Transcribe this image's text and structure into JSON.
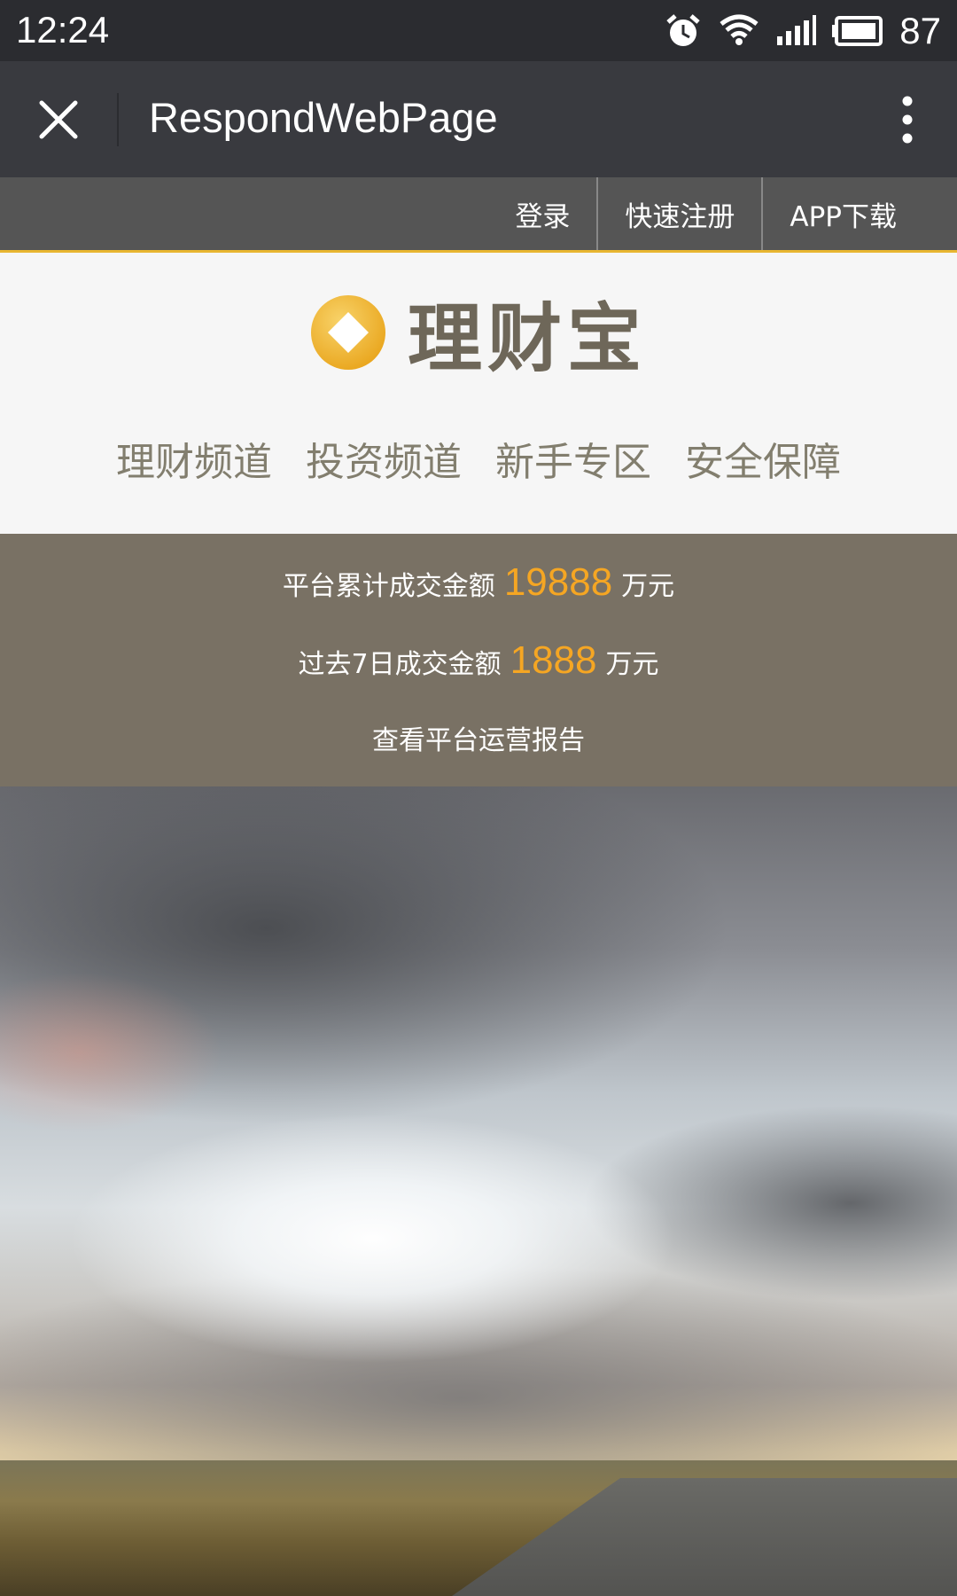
{
  "status_bar": {
    "time": "12:24",
    "battery_level": "87"
  },
  "title_bar": {
    "title": "RespondWebPage"
  },
  "top_nav": {
    "items": [
      "登录",
      "快速注册",
      "APP下载"
    ]
  },
  "brand": {
    "name": "理财宝",
    "accent_color": "#f0b024"
  },
  "main_nav": {
    "items": [
      "理财频道",
      "投资频道",
      "新手专区",
      "安全保障"
    ]
  },
  "stats": {
    "total_label": "平台累计成交金额",
    "total_value": "19888",
    "total_unit": "万元",
    "week_label": "过去7日成交金额",
    "week_value": "1888",
    "week_unit": "万元",
    "report_link": "查看平台运营报告",
    "highlight_color": "#f5a623"
  }
}
